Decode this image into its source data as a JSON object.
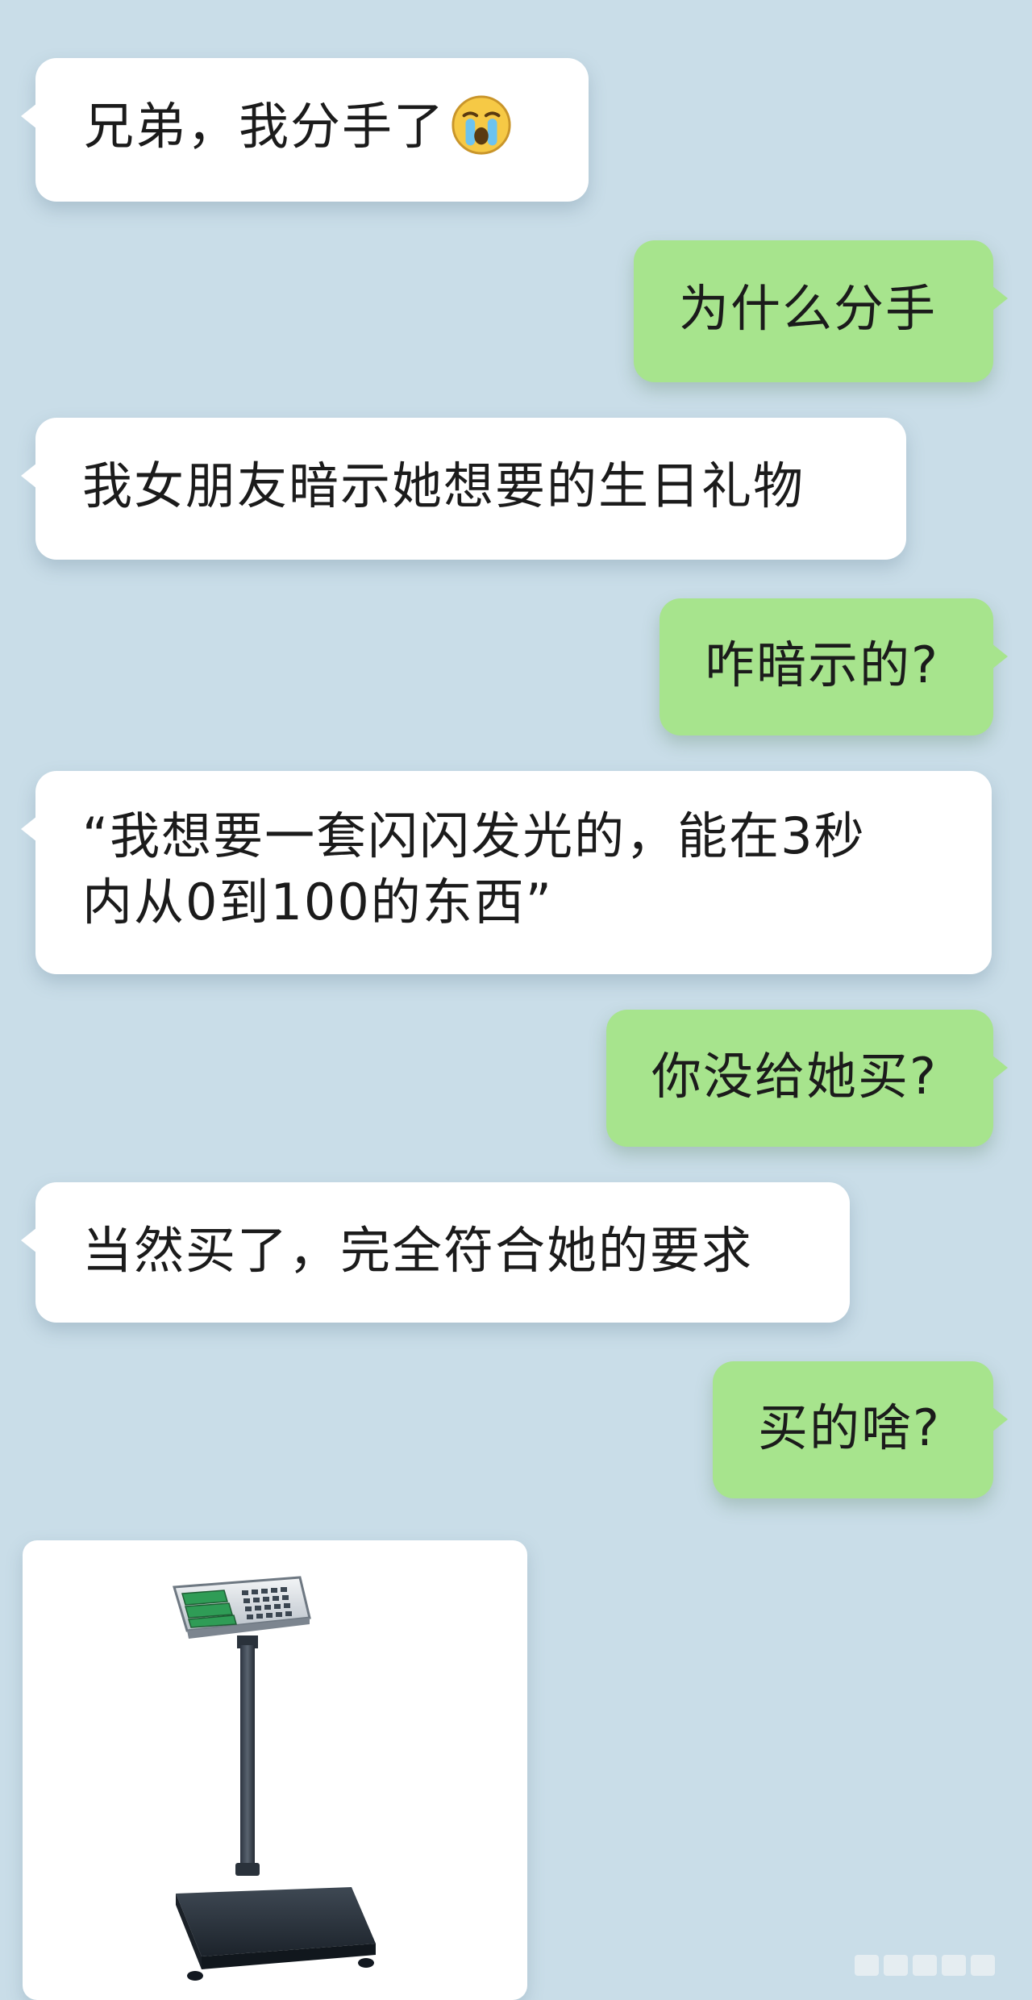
{
  "messages": [
    {
      "side": "left",
      "text": "兄弟，我分手了",
      "emoji": "crying-face-icon"
    },
    {
      "side": "right",
      "text": "为什么分手"
    },
    {
      "side": "left",
      "text": "我女朋友暗示她想要的生日礼物"
    },
    {
      "side": "right",
      "text": "咋暗示的?"
    },
    {
      "side": "left",
      "lines": [
        "“我想要一套闪闪发光的，能在3秒",
        "内从0到100的东西”"
      ]
    },
    {
      "side": "right",
      "text": "你没给她买?"
    },
    {
      "side": "left",
      "text": "当然买了，完全符合她的要求"
    },
    {
      "side": "right",
      "text": "买的啥?"
    }
  ],
  "image_message": {
    "subject": "digital-weighing-scale"
  },
  "colors": {
    "background": "#c9dde8",
    "incoming_bubble": "#ffffff",
    "outgoing_bubble": "#a7e48d",
    "text": "#1b1b1b"
  }
}
